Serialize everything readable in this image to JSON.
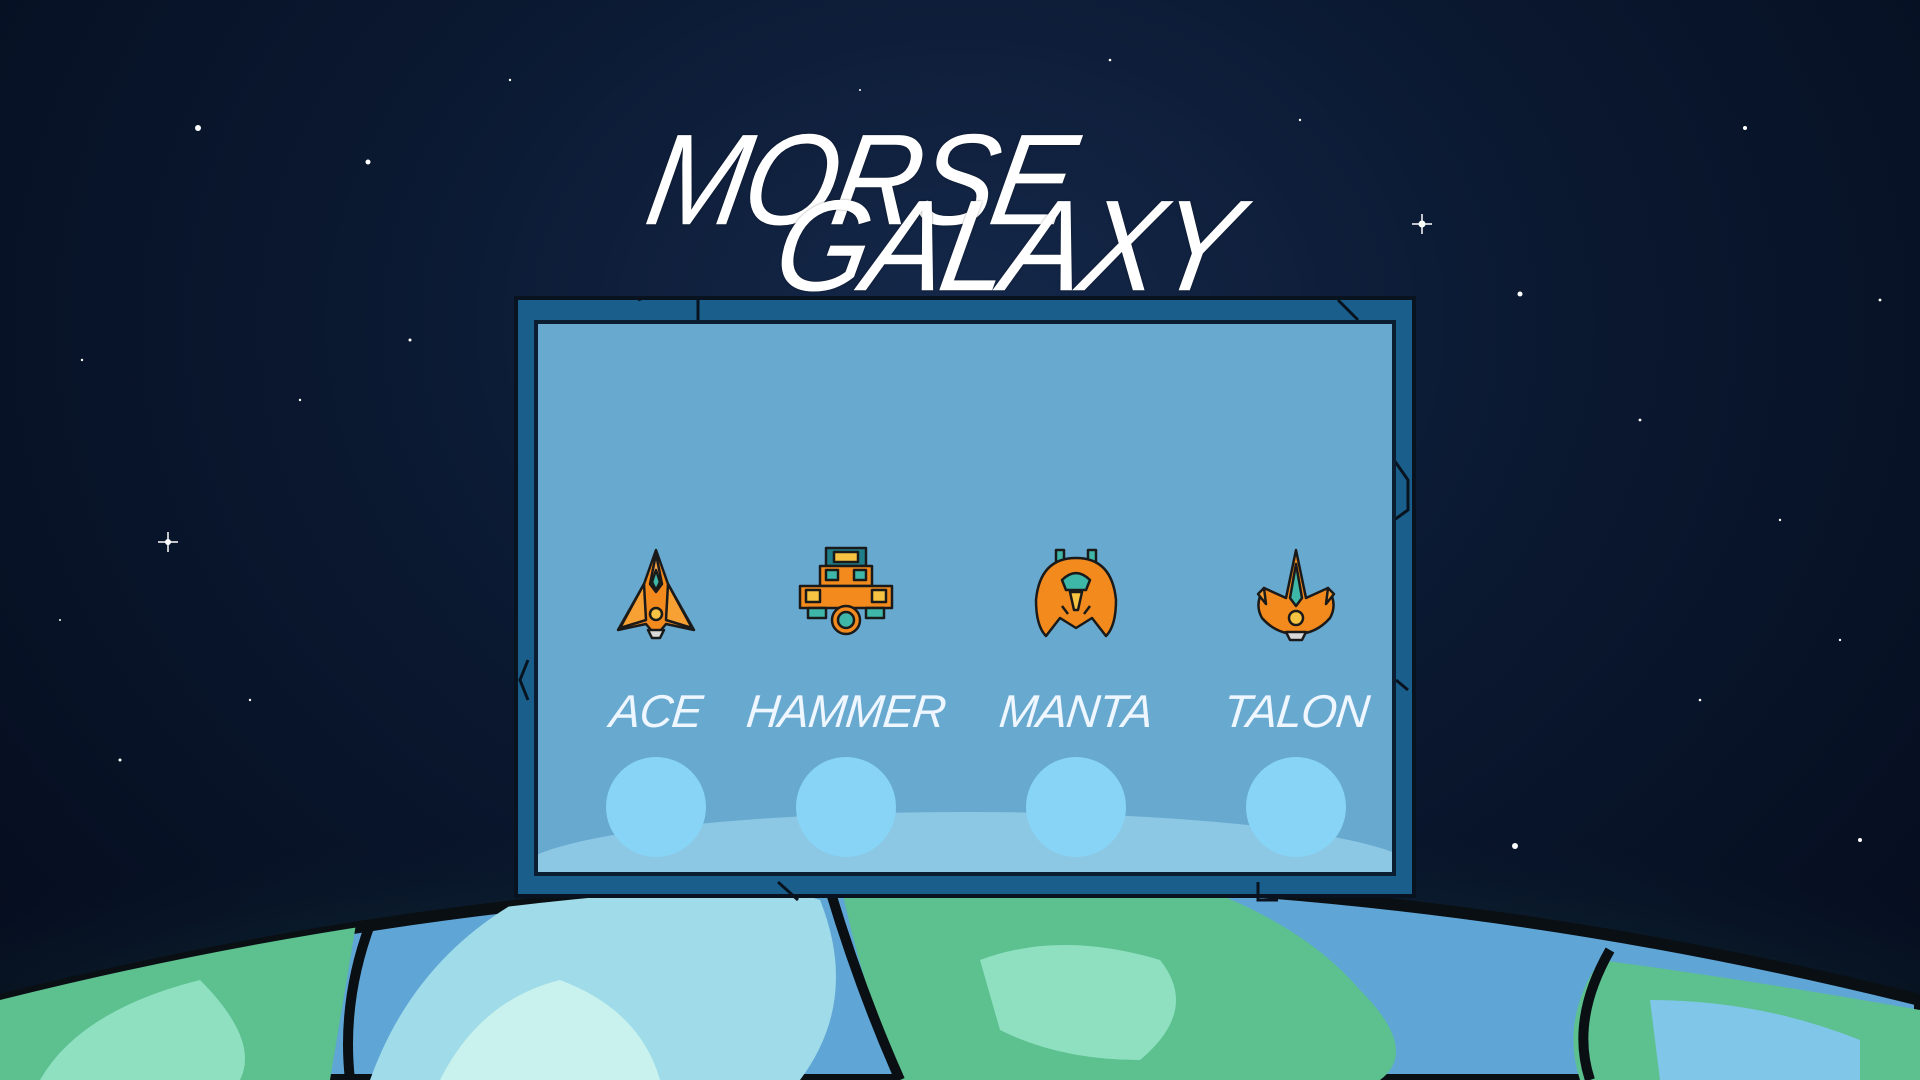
{
  "game": {
    "title_line1": "MORSE",
    "title_line2": "GALAXY"
  },
  "ships": [
    {
      "name": "ACE",
      "icon": "ace-ship-icon"
    },
    {
      "name": "HAMMER",
      "icon": "hammer-ship-icon"
    },
    {
      "name": "MANTA",
      "icon": "manta-ship-icon"
    },
    {
      "name": "TALON",
      "icon": "talon-ship-icon"
    }
  ],
  "colors": {
    "sky": "#0a1830",
    "panel_frame": "#1a5f8c",
    "panel_fill": "#7fbee1",
    "select_button": "#87d4f7",
    "ship_orange": "#f28a1e",
    "ship_teal": "#3fb7a8",
    "planet_ocean": "#5fa6d6",
    "planet_land": "#5cc08f"
  }
}
